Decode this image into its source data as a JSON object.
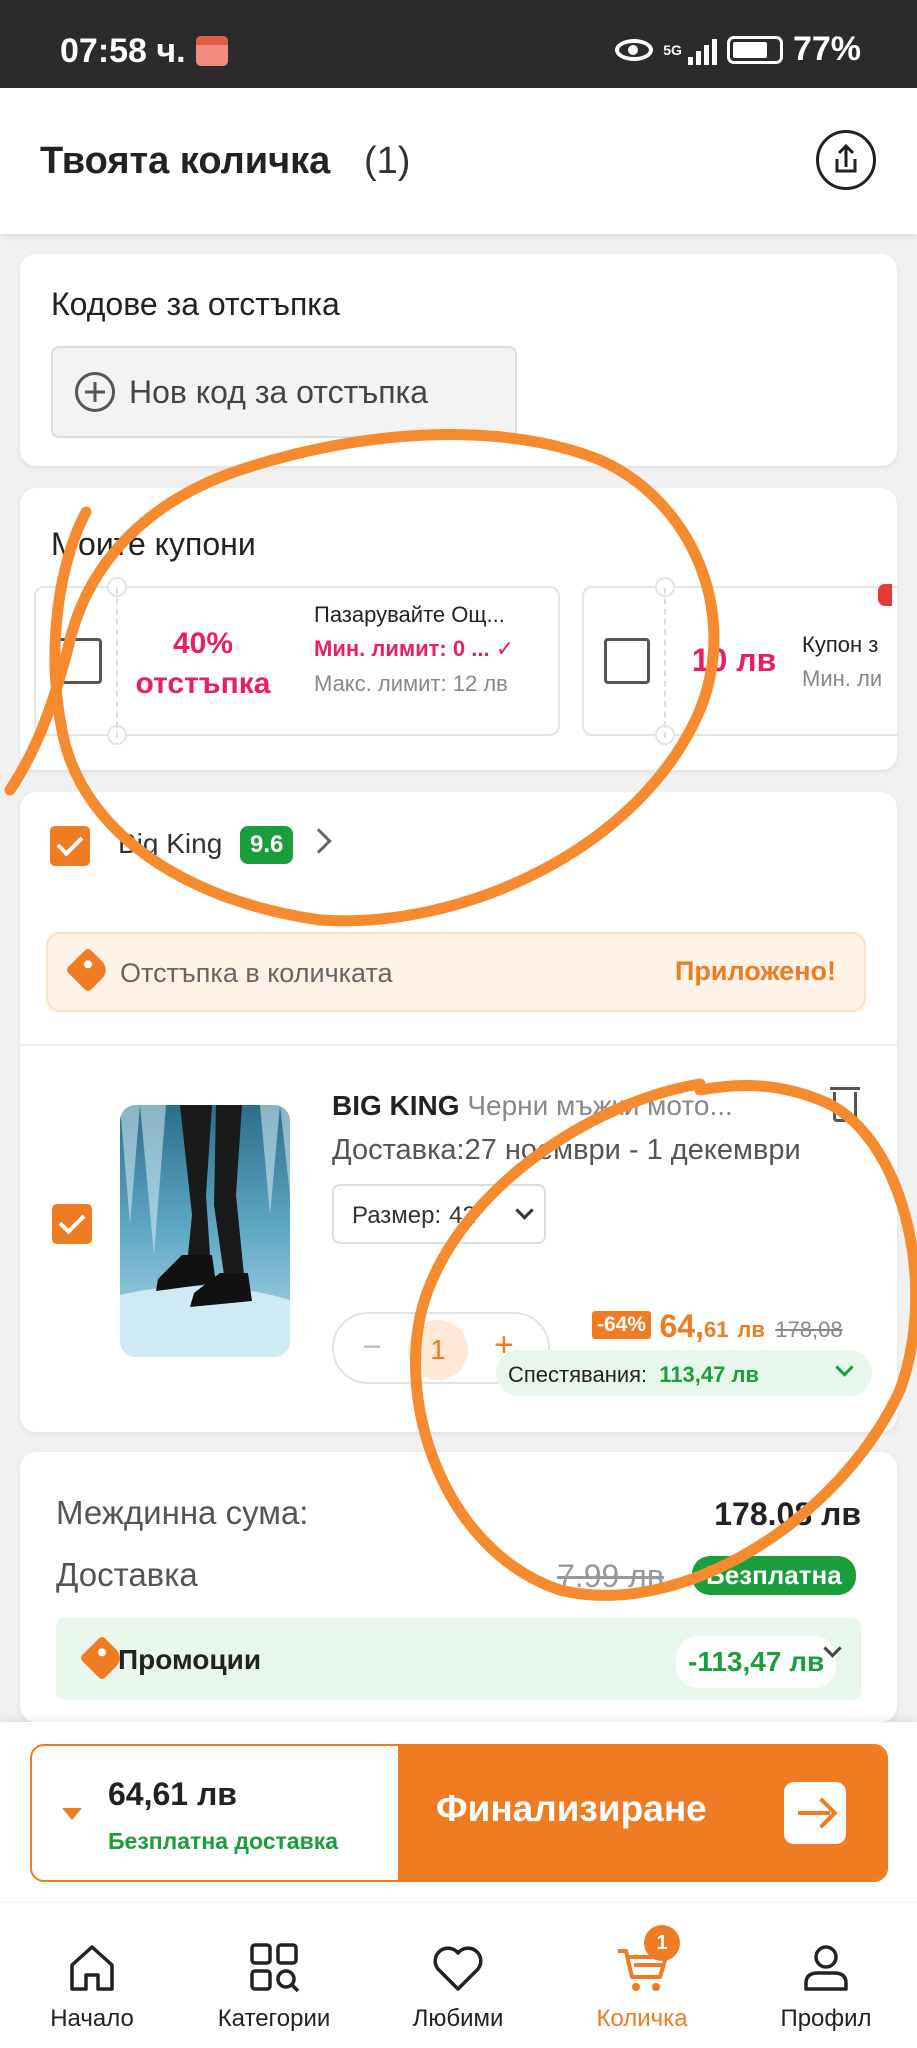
{
  "status_bar": {
    "time": "07:58 ч.",
    "network": "5G",
    "battery": "77%"
  },
  "header": {
    "title": "Твоята количка",
    "count": "(1)"
  },
  "discount_codes": {
    "heading": "Кодове за отстъпка",
    "new_code_label": "Нов код за отстъпка"
  },
  "coupons": {
    "heading": "Моите купони",
    "items": [
      {
        "amount": "40% отстъпка",
        "title": "Пазарувайте Ощ...",
        "min_limit": "Мин. лимит: 0 ...",
        "max_limit": "Макс. лимит: 12 лв"
      },
      {
        "amount": "10 лв",
        "title": "Купон з",
        "min_limit": "Мин. ли"
      }
    ]
  },
  "store": {
    "name": "Big King",
    "score": "9.6",
    "quantity_discount_label": "Отстъпка в количката",
    "quantity_discount_status": "Приложено!"
  },
  "product": {
    "brand": "BIG KING",
    "name": "Черни мъжки мото...",
    "delivery": "Доставка:27  ноември - 1  декември",
    "size_label": "Размер:",
    "size_value": "42",
    "quantity": "1",
    "discount_badge": "-64%",
    "price_main": "64,",
    "price_cents": "61",
    "price_currency": "лв",
    "old_price": "178,08",
    "savings_label": "Спестявания:",
    "savings_value": "113,47 лв"
  },
  "summary": {
    "subtotal_label": "Междинна сума:",
    "subtotal_value": "178.08 лв",
    "delivery_label": "Доставка",
    "delivery_old": "7.99 лв",
    "delivery_free": "Безплатна",
    "promotions_label": "Промоции",
    "promotions_value": "-113,47 лв"
  },
  "checkout": {
    "total": "64,61 лв",
    "free_delivery": "Безплатна доставка",
    "button_label": "Финализиране"
  },
  "nav": {
    "items": [
      {
        "label": "Начало",
        "icon": "home-icon"
      },
      {
        "label": "Категории",
        "icon": "categories-icon"
      },
      {
        "label": "Любими",
        "icon": "heart-icon"
      },
      {
        "label": "Количка",
        "icon": "cart-icon",
        "badge": "1",
        "active": true
      },
      {
        "label": "Профил",
        "icon": "profile-icon"
      }
    ]
  },
  "colors": {
    "accent": "#ef7b22",
    "pink": "#e91e63",
    "green": "#1a9e3b"
  }
}
